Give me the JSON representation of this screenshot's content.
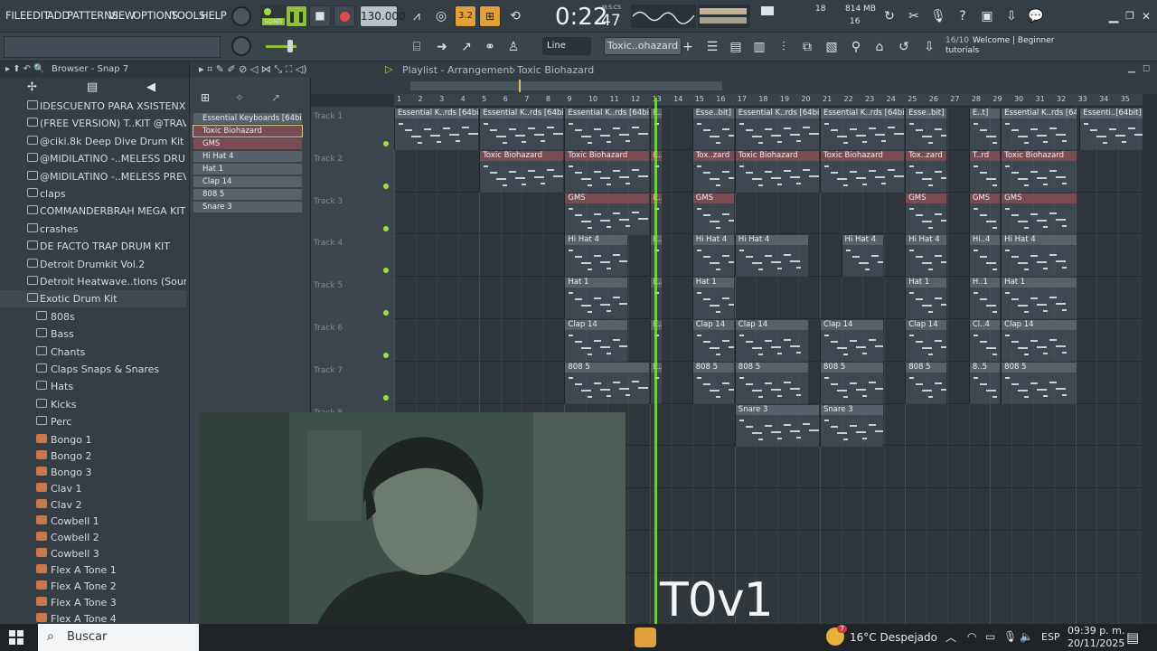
{
  "menu": [
    "FILE",
    "EDIT",
    "ADD",
    "PATTERNS",
    "VIEW",
    "OPTIONS",
    "TOOLS",
    "HELP"
  ],
  "transport": {
    "song_label": "SONG",
    "tempo": "130.000",
    "time_label": "M:S:CS",
    "time_main": "0:22",
    "time_cs": "47",
    "cpu_value": "18",
    "ram_mb": "814 MB",
    "voices": "16",
    "snap_value": "3.2"
  },
  "toolbar2": {
    "line_select": "Line",
    "pattern_name": "Toxic..ohazard",
    "hint_count": "16/10",
    "hint_title": "Welcome | Beginner",
    "hint_sub": "tutorials"
  },
  "browser": {
    "title": "Browser - Snap 7",
    "folders": [
      "IDESCUENTO PARA XSISTENX",
      "(FREE VERSION) T..KIT @TRAVABEATS",
      "@ciki.8k Deep Dive Drum Kit",
      "@MIDILATINO -..MELESS DRUM KIT",
      "@MIDILATINO -..MELESS PREVIEWS",
      "claps",
      "COMMANDERBRAH MEGA KIT",
      "crashes",
      "DE FACTO TRAP DRUM KIT",
      "Detroit Drumkit Vol.2",
      "Detroit Heatwave..tions (Sound Kit)",
      "Exotic Drum Kit"
    ],
    "subfolders": [
      "808s",
      "Bass",
      "Chants",
      "Claps Snaps & Snares",
      "Hats",
      "Kicks",
      "Perc"
    ],
    "files": [
      "Bongo 1",
      "Bongo 2",
      "Bongo 3",
      "Clav 1",
      "Clav 2",
      "Cowbell 1",
      "Cowbell 2",
      "Cowbell 3",
      "Flex A Tone 1",
      "Flex A Tone 2",
      "Flex A Tone 3",
      "Flex A Tone 4"
    ]
  },
  "playlist": {
    "title": "Playlist - Arrangement",
    "pattern": "Toxic Biohazard",
    "picker": [
      "Essential Keyboards [64bit]",
      "Toxic Biohazard",
      "GMS",
      "Hi Hat 4",
      "Hat 1",
      "Clap 14",
      "808 5",
      "Snare 3"
    ],
    "tracks": [
      "Track 1",
      "Track 2",
      "Track 3",
      "Track 4",
      "Track 5",
      "Track 6",
      "Track 7",
      "Track 8"
    ],
    "ruler": [
      "1",
      "2",
      "3",
      "4",
      "5",
      "6",
      "7",
      "8",
      "9",
      "10",
      "11",
      "12",
      "13",
      "14",
      "15",
      "16",
      "17",
      "18",
      "19",
      "20",
      "21",
      "22",
      "23",
      "24",
      "25",
      "26",
      "27",
      "28",
      "29",
      "30",
      "31",
      "32",
      "33",
      "34",
      "35"
    ]
  },
  "clips": {
    "keys_full": "Essential K..rds [64bit]",
    "keys_short": "Esse..bit]",
    "keys_tiny": "E..t]",
    "keys_end": "Essenti..[64bit]",
    "toxic": "Toxic Biohazard",
    "toxic_short": "Tox..zard",
    "toxic_tiny": "T..rd",
    "gms": "GMS",
    "hihat": "Hi Hat 4",
    "hihat_tiny": "Hi..4",
    "hat": "Hat 1",
    "hat_tiny": "H..1",
    "clap": "Clap 14",
    "clap_tiny": "Cl..4",
    "bass": "808 5",
    "bass_tiny": "8..5",
    "snare": "Snare 3"
  },
  "taskbar": {
    "search": "Buscar",
    "weather": "16°C  Despejado",
    "weather_badge": "7",
    "lang": "ESP",
    "time": "09:39 p. m.",
    "date": "20/11/2025"
  },
  "overlay_text": "T0v1"
}
